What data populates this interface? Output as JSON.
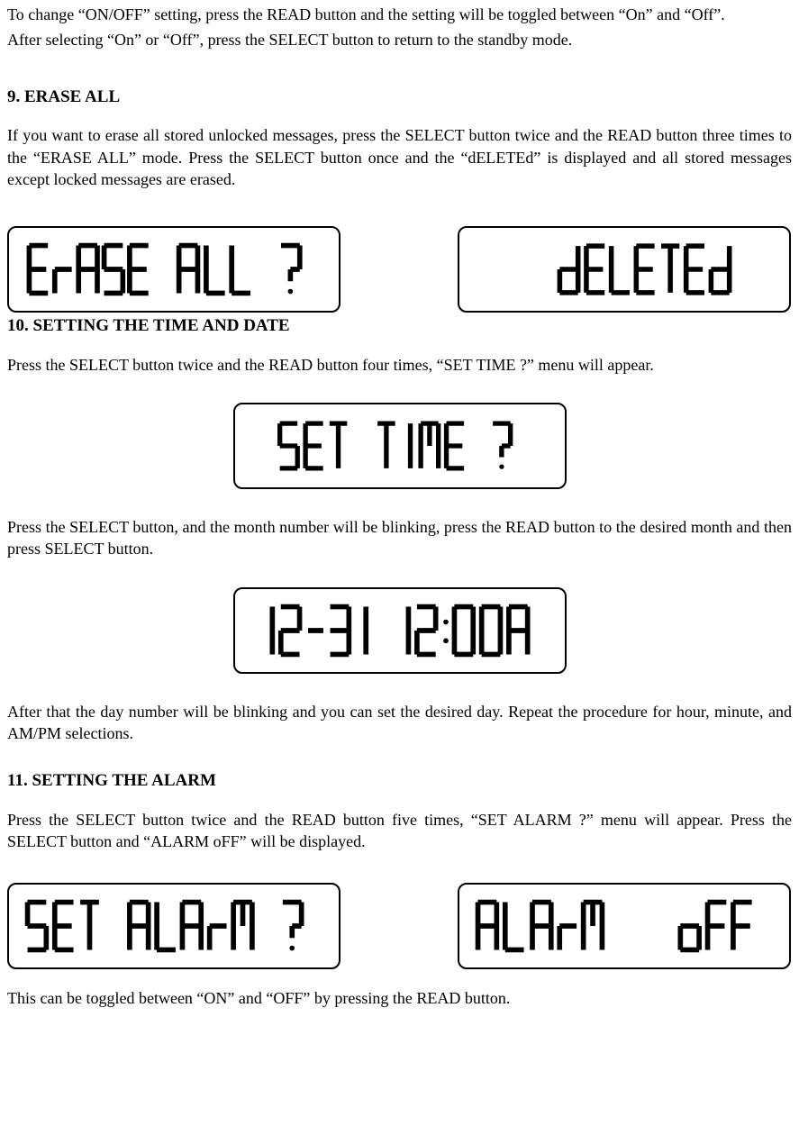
{
  "intro": {
    "line1": "To change “ON/OFF” setting, press the READ button and the setting will be toggled between “On” and “Off”.",
    "line2": "After selecting “On” or “Off”, press the SELECT button to return to the standby mode."
  },
  "section9": {
    "heading": "9. ERASE ALL",
    "body": "If you want to erase all stored unlocked messages, press the SELECT button twice and the READ button three times to the “ERASE ALL” mode. Press the SELECT button once and the “dELETEd” is displayed and all stored messages except locked messages are erased.",
    "lcd1": "ERASE ALL ?",
    "lcd2": "dELETEd"
  },
  "section10": {
    "heading": "10. SETTING THE TIME AND DATE",
    "body1": "Press the SELECT button twice and the READ button four times, “SET TIME ?” menu will appear.",
    "lcd_settime": "SET TIME ?",
    "body2": "Press the SELECT button, and the month number will be blinking, press the READ button to the desired month and then press SELECT button.",
    "lcd_clock": "12-31 12:00A",
    "body3": "After that the day number will be blinking and you can set the desired day. Repeat the procedure for hour, minute, and AM/PM selections."
  },
  "section11": {
    "heading": "11. SETTING THE ALARM",
    "body1": "Press the SELECT button twice and the READ button five times, “SET ALARM ?” menu will appear. Press the SELECT button and “ALARM oFF” will be displayed.",
    "lcd1": "SET ALARM ?",
    "lcd2": "ALARM  oFF",
    "body2": "This can be toggled between “ON” and “OFF” by pressing the READ button."
  }
}
